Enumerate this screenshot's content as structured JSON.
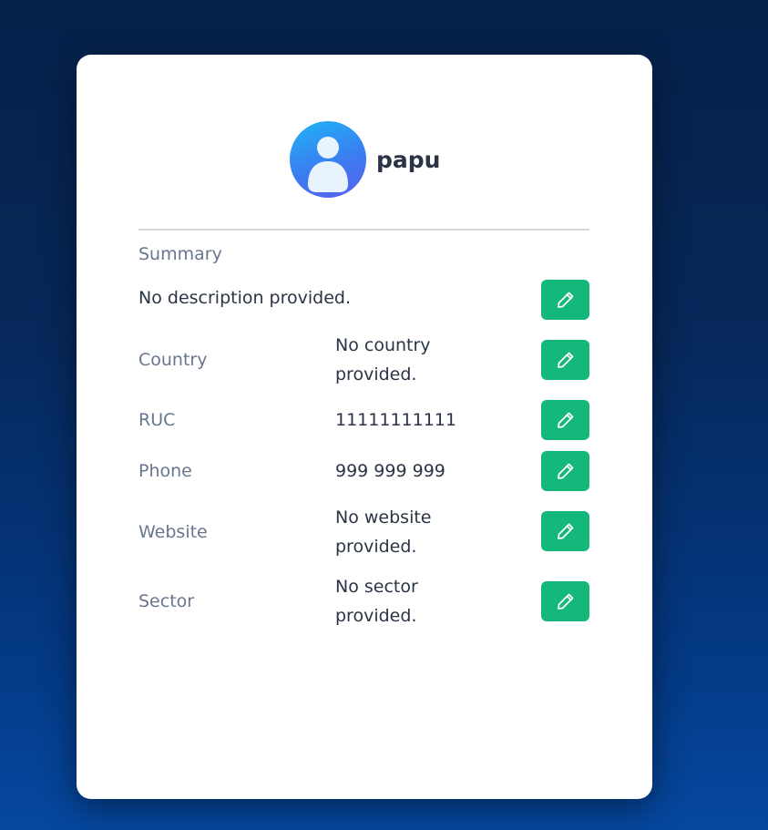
{
  "profile": {
    "name": "papu"
  },
  "summary": {
    "label": "Summary",
    "value": "No description provided."
  },
  "fields": [
    {
      "label": "Country",
      "value": "No country provided."
    },
    {
      "label": "RUC",
      "value": "11111111111"
    },
    {
      "label": "Phone",
      "value": "999 999 999"
    },
    {
      "label": "Website",
      "value": "No website provided."
    },
    {
      "label": "Sector",
      "value": "No sector provided."
    }
  ],
  "colors": {
    "edit_button": "#14b87a",
    "label_text": "#68778d",
    "value_text": "#2b3445"
  },
  "icons": {
    "edit": "pencil-icon",
    "avatar": "user-silhouette-icon"
  }
}
